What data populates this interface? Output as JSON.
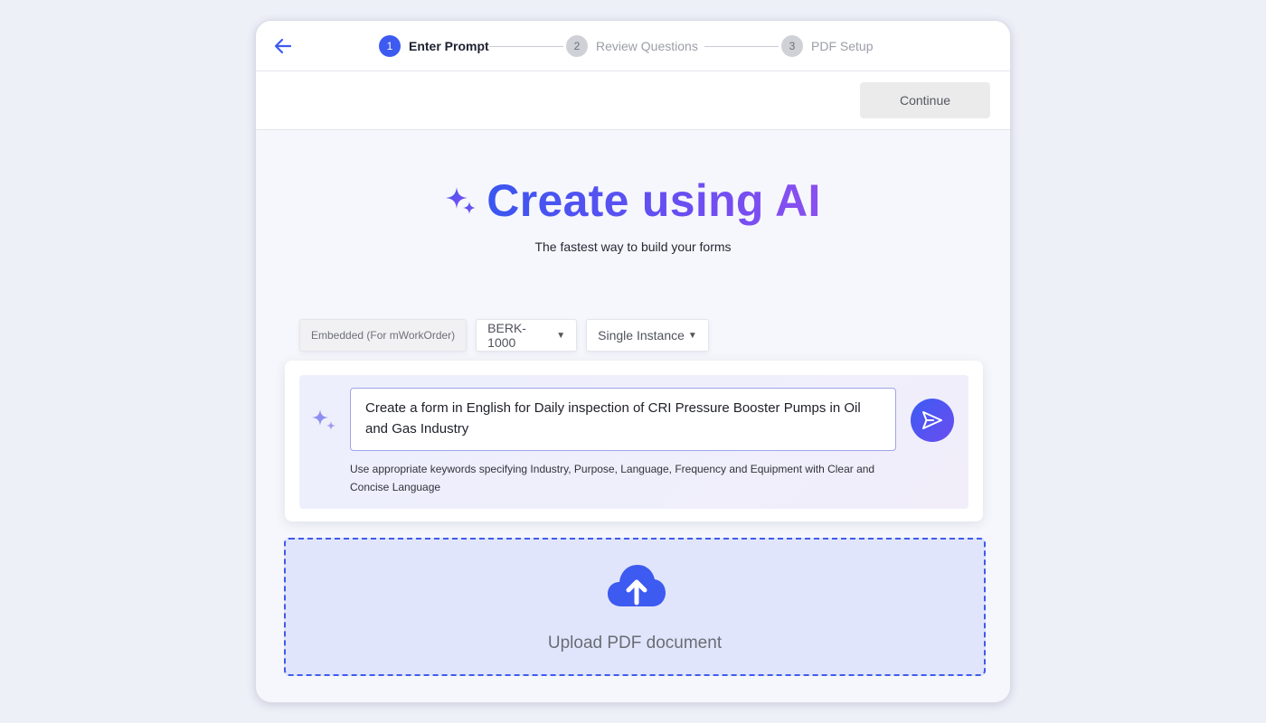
{
  "stepper": {
    "steps": [
      {
        "number": "1",
        "label": "Enter Prompt"
      },
      {
        "number": "2",
        "label": "Review Questions"
      },
      {
        "number": "3",
        "label": "PDF Setup"
      }
    ]
  },
  "toolbar": {
    "continue_label": "Continue"
  },
  "hero": {
    "title": "Create using AI",
    "subtitle": "The fastest way to build your forms"
  },
  "filters": {
    "embedded_label": "Embedded (For mWorkOrder)",
    "asset_selected": "BERK-1000",
    "instance_selected": "Single Instance"
  },
  "prompt": {
    "value": "Create a form in English for Daily inspection of CRI Pressure Booster Pumps in Oil and Gas Industry",
    "hint": "Use appropriate keywords specifying Industry, Purpose, Language, Frequency and Equipment with Clear and Concise Language"
  },
  "upload": {
    "label": "Upload PDF document"
  },
  "colors": {
    "accent": "#3d5af1",
    "gradient_end": "#8b4ff0",
    "upload_bg": "#e1e5fb"
  },
  "icons": {
    "back": "arrow-left-icon",
    "sparkle": "sparkle-icon",
    "send": "send-icon",
    "upload": "cloud-upload-icon",
    "caret": "caret-down-icon"
  }
}
